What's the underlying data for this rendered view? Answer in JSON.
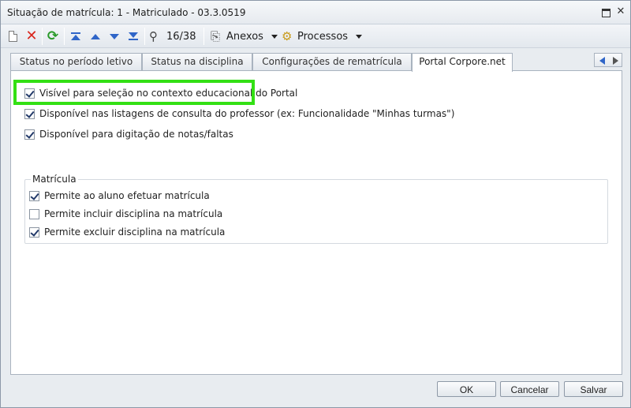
{
  "window": {
    "title": "Situação de matrícula: 1 - Matriculado - 03.3.0519"
  },
  "toolbar": {
    "record_counter": "16/38",
    "attachments_label": "Anexos",
    "processes_label": "Processos",
    "icons": [
      "new-icon",
      "delete-icon",
      "refresh-icon",
      "first-record-icon",
      "previous-record-icon",
      "next-record-icon",
      "last-record-icon",
      "find-icon",
      "attachments-icon",
      "processes-icon"
    ]
  },
  "tabs": [
    {
      "label": "Status no período letivo"
    },
    {
      "label": "Status na disciplina"
    },
    {
      "label": "Configurações de rematrícula"
    },
    {
      "label": "Portal Corpore.net"
    }
  ],
  "active_tab": "Portal Corpore.net",
  "portal": {
    "options": [
      {
        "label": "Visível para seleção no contexto educacional do Portal",
        "checked": true
      },
      {
        "label": "Disponível nas listagens de consulta do professor (ex: Funcionalidade \"Minhas turmas\")",
        "checked": true
      },
      {
        "label": "Disponível para digitação de notas/faltas",
        "checked": true
      }
    ]
  },
  "matricula": {
    "legend": "Matrícula",
    "options": [
      {
        "label": "Permite ao aluno efetuar matrícula",
        "checked": true
      },
      {
        "label": "Permite incluir disciplina na matrícula",
        "checked": false
      },
      {
        "label": "Permite excluir disciplina na matrícula",
        "checked": true
      }
    ]
  },
  "footer": {
    "ok_label": "OK",
    "cancel_label": "Cancelar",
    "save_label": "Salvar"
  },
  "colors": {
    "highlight": "#33e014",
    "accent": "#2f65c8"
  }
}
